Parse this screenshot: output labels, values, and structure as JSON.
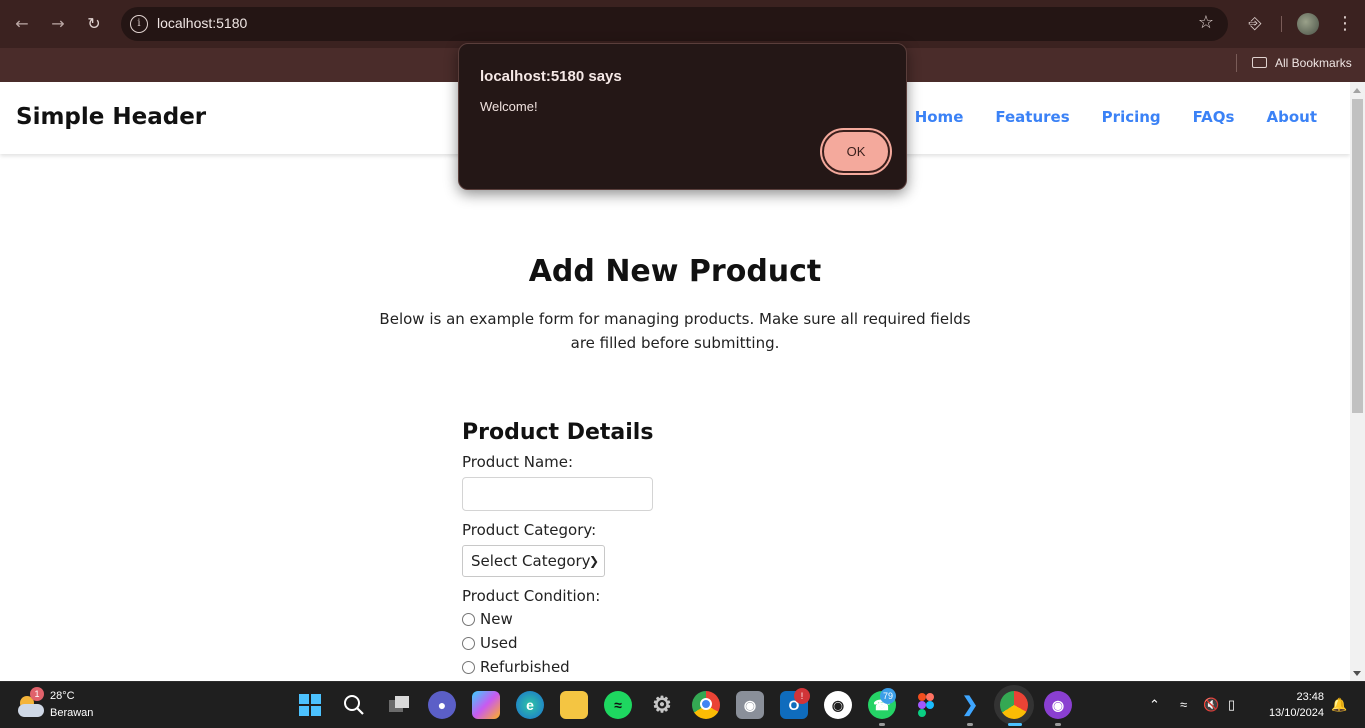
{
  "browser": {
    "url": "localhost:5180",
    "all_bookmarks_label": "All Bookmarks"
  },
  "site": {
    "title": "Simple Header",
    "nav": [
      "Home",
      "Features",
      "Pricing",
      "FAQs",
      "About"
    ]
  },
  "main": {
    "title": "Add New Product",
    "intro": "Below is an example form for managing products. Make sure all required fields are filled before submitting."
  },
  "form": {
    "heading": "Product Details",
    "name_label": "Product Name:",
    "name_value": "",
    "category_label": "Product Category:",
    "category_selected": "Select Category",
    "condition_label": "Product Condition:",
    "condition_options": [
      "New",
      "Used",
      "Refurbished"
    ]
  },
  "dialog": {
    "title": "localhost:5180 says",
    "message": "Welcome!",
    "ok_label": "OK"
  },
  "taskbar": {
    "weather_temp": "28°C",
    "weather_condition": "Berawan",
    "weather_badge": "1",
    "whatsapp_badge": "79",
    "outlook_badge": "!",
    "time": "23:48",
    "date": "13/10/2024",
    "icons": [
      "windows-start-icon",
      "search-icon",
      "task-view-icon",
      "teams-icon",
      "copilot-icon",
      "edge-icon",
      "file-explorer-icon",
      "spotify-icon",
      "settings-icon",
      "chrome-icon",
      "camera-icon",
      "outlook-icon",
      "github-icon",
      "whatsapp-icon",
      "figma-icon",
      "vscode-icon",
      "chrome-profile-icon",
      "github-desktop-icon"
    ]
  },
  "colors": {
    "nav_link": "#3b82f6",
    "chrome_bg": "#3b2220",
    "dialog_bg": "#241716",
    "ok_button": "#f4a99c",
    "taskbar_bg": "#1f1f1f"
  }
}
